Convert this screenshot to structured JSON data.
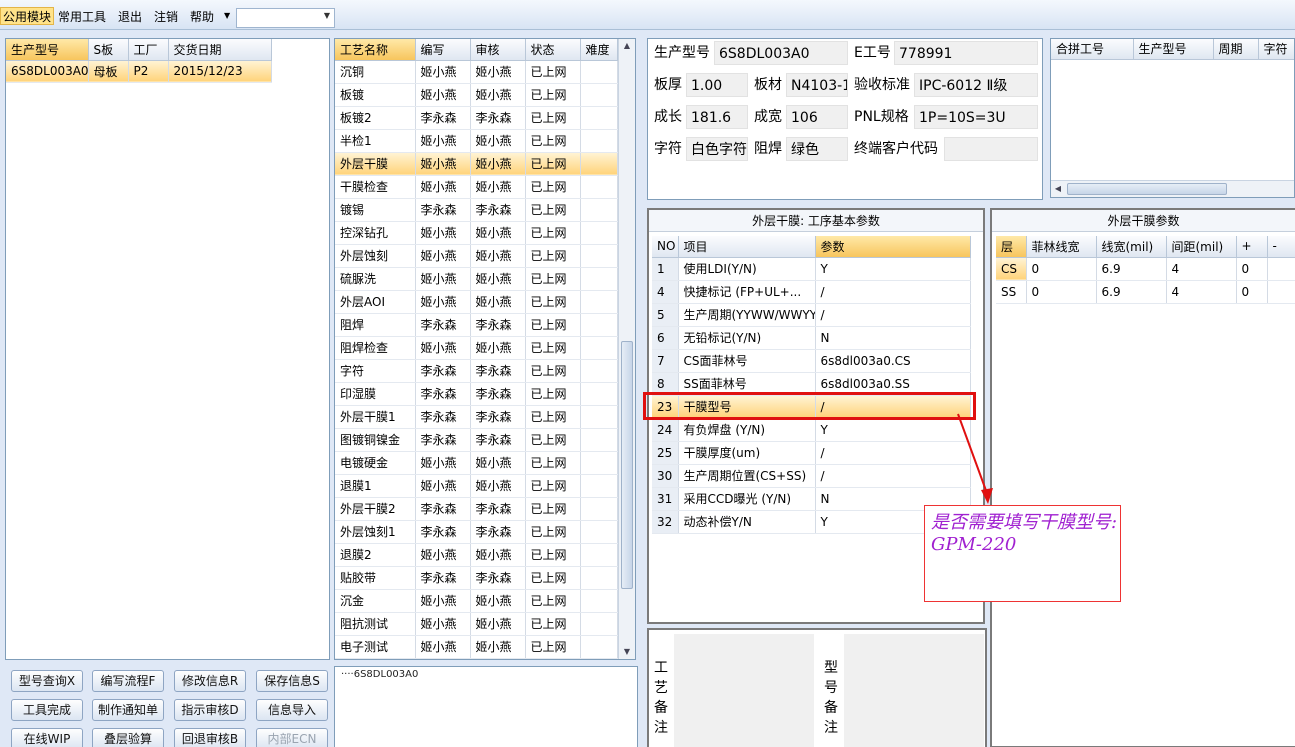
{
  "menu": {
    "items": [
      "公用模块",
      "常用工具",
      "退出",
      "注销",
      "帮助"
    ],
    "combo_value": ""
  },
  "order_list": {
    "columns": [
      "生产型号",
      "S板",
      "工厂",
      "交货日期"
    ],
    "rows": [
      [
        "6S8DL003A0",
        "母板",
        "P2",
        "2015/12/23"
      ]
    ]
  },
  "process_list": {
    "columns": [
      "工艺名称",
      "编写",
      "审核",
      "状态",
      "难度"
    ],
    "rows": [
      [
        "沉铜",
        "姬小燕",
        "姬小燕",
        "已上网",
        ""
      ],
      [
        "板镀",
        "姬小燕",
        "姬小燕",
        "已上网",
        ""
      ],
      [
        "板镀2",
        "李永森",
        "李永森",
        "已上网",
        ""
      ],
      [
        "半检1",
        "姬小燕",
        "姬小燕",
        "已上网",
        ""
      ],
      [
        "外层干膜",
        "姬小燕",
        "姬小燕",
        "已上网",
        ""
      ],
      [
        "干膜检查",
        "姬小燕",
        "姬小燕",
        "已上网",
        ""
      ],
      [
        "镀锡",
        "李永森",
        "李永森",
        "已上网",
        ""
      ],
      [
        "控深钻孔",
        "姬小燕",
        "姬小燕",
        "已上网",
        ""
      ],
      [
        "外层蚀刻",
        "姬小燕",
        "姬小燕",
        "已上网",
        ""
      ],
      [
        "硫脲洗",
        "姬小燕",
        "姬小燕",
        "已上网",
        ""
      ],
      [
        "外层AOI",
        "姬小燕",
        "姬小燕",
        "已上网",
        ""
      ],
      [
        "阻焊",
        "李永森",
        "李永森",
        "已上网",
        ""
      ],
      [
        "阻焊检查",
        "姬小燕",
        "姬小燕",
        "已上网",
        ""
      ],
      [
        "字符",
        "李永森",
        "李永森",
        "已上网",
        ""
      ],
      [
        "印湿膜",
        "李永森",
        "李永森",
        "已上网",
        ""
      ],
      [
        "外层干膜1",
        "李永森",
        "李永森",
        "已上网",
        ""
      ],
      [
        "图镀铜镍金",
        "李永森",
        "李永森",
        "已上网",
        ""
      ],
      [
        "电镀硬金",
        "姬小燕",
        "姬小燕",
        "已上网",
        ""
      ],
      [
        "退膜1",
        "姬小燕",
        "姬小燕",
        "已上网",
        ""
      ],
      [
        "外层干膜2",
        "李永森",
        "李永森",
        "已上网",
        ""
      ],
      [
        "外层蚀刻1",
        "李永森",
        "李永森",
        "已上网",
        ""
      ],
      [
        "退膜2",
        "姬小燕",
        "姬小燕",
        "已上网",
        ""
      ],
      [
        "贴胶带",
        "李永森",
        "李永森",
        "已上网",
        ""
      ],
      [
        "沉金",
        "姬小燕",
        "姬小燕",
        "已上网",
        ""
      ],
      [
        "阻抗测试",
        "姬小燕",
        "姬小燕",
        "已上网",
        ""
      ],
      [
        "电子测试",
        "姬小燕",
        "姬小燕",
        "已上网",
        ""
      ]
    ]
  },
  "info": {
    "model_label": "生产型号",
    "model_value": "6S8DL003A0",
    "eno_label": "E工号",
    "eno_value": "778991",
    "thickness_label": "板厚",
    "thickness_value": "1.00",
    "material_label": "板材",
    "material_value": "N4103-1",
    "standard_label": "验收标准",
    "standard_value": "IPC-6012 Ⅱ级",
    "length_label": "成长",
    "length_value": "181.6",
    "width_label": "成宽",
    "width_value": "106",
    "pnl_label": "PNL规格",
    "pnl_value": "1P=10S=3U",
    "char_label": "字符",
    "char_value": "白色字符",
    "mask_label": "阻焊",
    "mask_value": "绿色",
    "customer_label": "终端客户代码",
    "customer_value": ""
  },
  "combine_grid": {
    "columns": [
      "合拼工号",
      "生产型号",
      "周期",
      "字符"
    ]
  },
  "step_params": {
    "title": "外层干膜: 工序基本参数",
    "columns": [
      "NO",
      "项目",
      "参数"
    ],
    "rows": [
      [
        "1",
        "使用LDI(Y/N)",
        "Y"
      ],
      [
        "4",
        "快捷标记 (FP+UL+...",
        "/"
      ],
      [
        "5",
        "生产周期(YYWW/WWYY)",
        "/"
      ],
      [
        "6",
        "无铅标记(Y/N)",
        "N"
      ],
      [
        "7",
        "CS面菲林号",
        "6s8dl003a0.CS"
      ],
      [
        "8",
        "SS面菲林号",
        "6s8dl003a0.SS"
      ],
      [
        "23",
        "干膜型号",
        "/"
      ],
      [
        "24",
        "有负焊盘 (Y/N)",
        "Y"
      ],
      [
        "25",
        "干膜厚度(um)",
        "/"
      ],
      [
        "30",
        "生产周期位置(CS+SS)",
        "/"
      ],
      [
        "31",
        "采用CCD曝光 (Y/N)",
        "N"
      ],
      [
        "32",
        "动态补偿Y/N",
        "Y"
      ]
    ]
  },
  "film_params": {
    "title": "外层干膜参数",
    "columns": [
      "层",
      "菲林线宽",
      "线宽(mil)",
      "间距(mil)",
      "+",
      "-"
    ],
    "rows": [
      [
        "CS",
        "0",
        "6.9",
        "4",
        "0",
        ""
      ],
      [
        "SS",
        "0",
        "6.9",
        "4",
        "0",
        ""
      ]
    ]
  },
  "buttons": [
    {
      "label": "型号查询X",
      "disabled": false
    },
    {
      "label": "编写流程F",
      "disabled": false
    },
    {
      "label": "修改信息R",
      "disabled": false
    },
    {
      "label": "保存信息S",
      "disabled": false
    },
    {
      "label": "工具完成",
      "disabled": false
    },
    {
      "label": "制作通知单",
      "disabled": false
    },
    {
      "label": "指示审核D",
      "disabled": false
    },
    {
      "label": "信息导入",
      "disabled": false
    },
    {
      "label": "在线WIP",
      "disabled": false
    },
    {
      "label": "叠层验算",
      "disabled": false
    },
    {
      "label": "回退审核B",
      "disabled": false
    },
    {
      "label": "内部ECN",
      "disabled": true
    }
  ],
  "tree_node": "6S8DL003A0",
  "memo": {
    "process_label": "工艺备注",
    "model_label": "型号备注"
  },
  "annotation": "是否需要填写干膜型号: GPM-220",
  "colors": {
    "selection": "#ffd37a",
    "highlight_border": "#e01010",
    "annotation_text": "#a020d0"
  }
}
